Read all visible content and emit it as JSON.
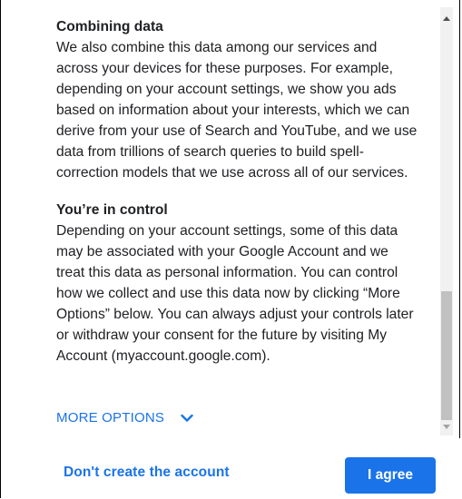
{
  "sections": [
    {
      "heading": "Combining data",
      "body": "We also combine this data among our services and across your devices for these purposes. For example, depending on your account settings, we show you ads based on information about your interests, which we can derive from your use of Search and YouTube, and we use data from trillions of search queries to build spell-correction models that we use across all of our services."
    },
    {
      "heading": "You’re in control",
      "body": "Depending on your account settings, some of this data may be associated with your Google Account and we treat this data as personal information. You can control how we collect and use this data now by clicking “More Options” below. You can always adjust your controls later or withdraw your consent for the future by visiting My Account (myaccount.google.com)."
    }
  ],
  "more_options": {
    "label": "MORE OPTIONS",
    "icon": "chevron-down-icon"
  },
  "footer": {
    "decline_label": "Don't create the account",
    "agree_label": "I agree"
  },
  "colors": {
    "accent": "#1a73e8",
    "text": "#202124",
    "scrollbar_thumb": "#c1c1c1",
    "scrollbar_track": "#f1f1f1"
  }
}
